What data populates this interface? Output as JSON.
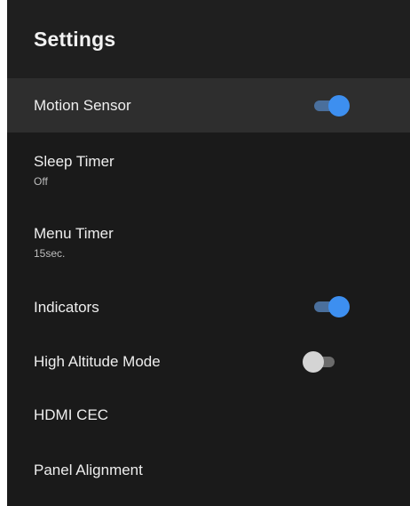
{
  "header": {
    "title": "Settings"
  },
  "items": [
    {
      "label": "Motion Sensor",
      "toggle": true
    },
    {
      "label": "Sleep Timer",
      "value": "Off"
    },
    {
      "label": "Menu Timer",
      "value": "15sec."
    },
    {
      "label": "Indicators",
      "toggle": true
    },
    {
      "label": "High Altitude Mode",
      "toggle": false
    },
    {
      "label": "HDMI CEC"
    },
    {
      "label": "Panel Alignment"
    }
  ],
  "colors": {
    "panel_background": "#1a1a1a",
    "selected_row": "#2e2e2e",
    "toggle_on": "#3d8ff0",
    "toggle_off": "#d4d4d4"
  }
}
